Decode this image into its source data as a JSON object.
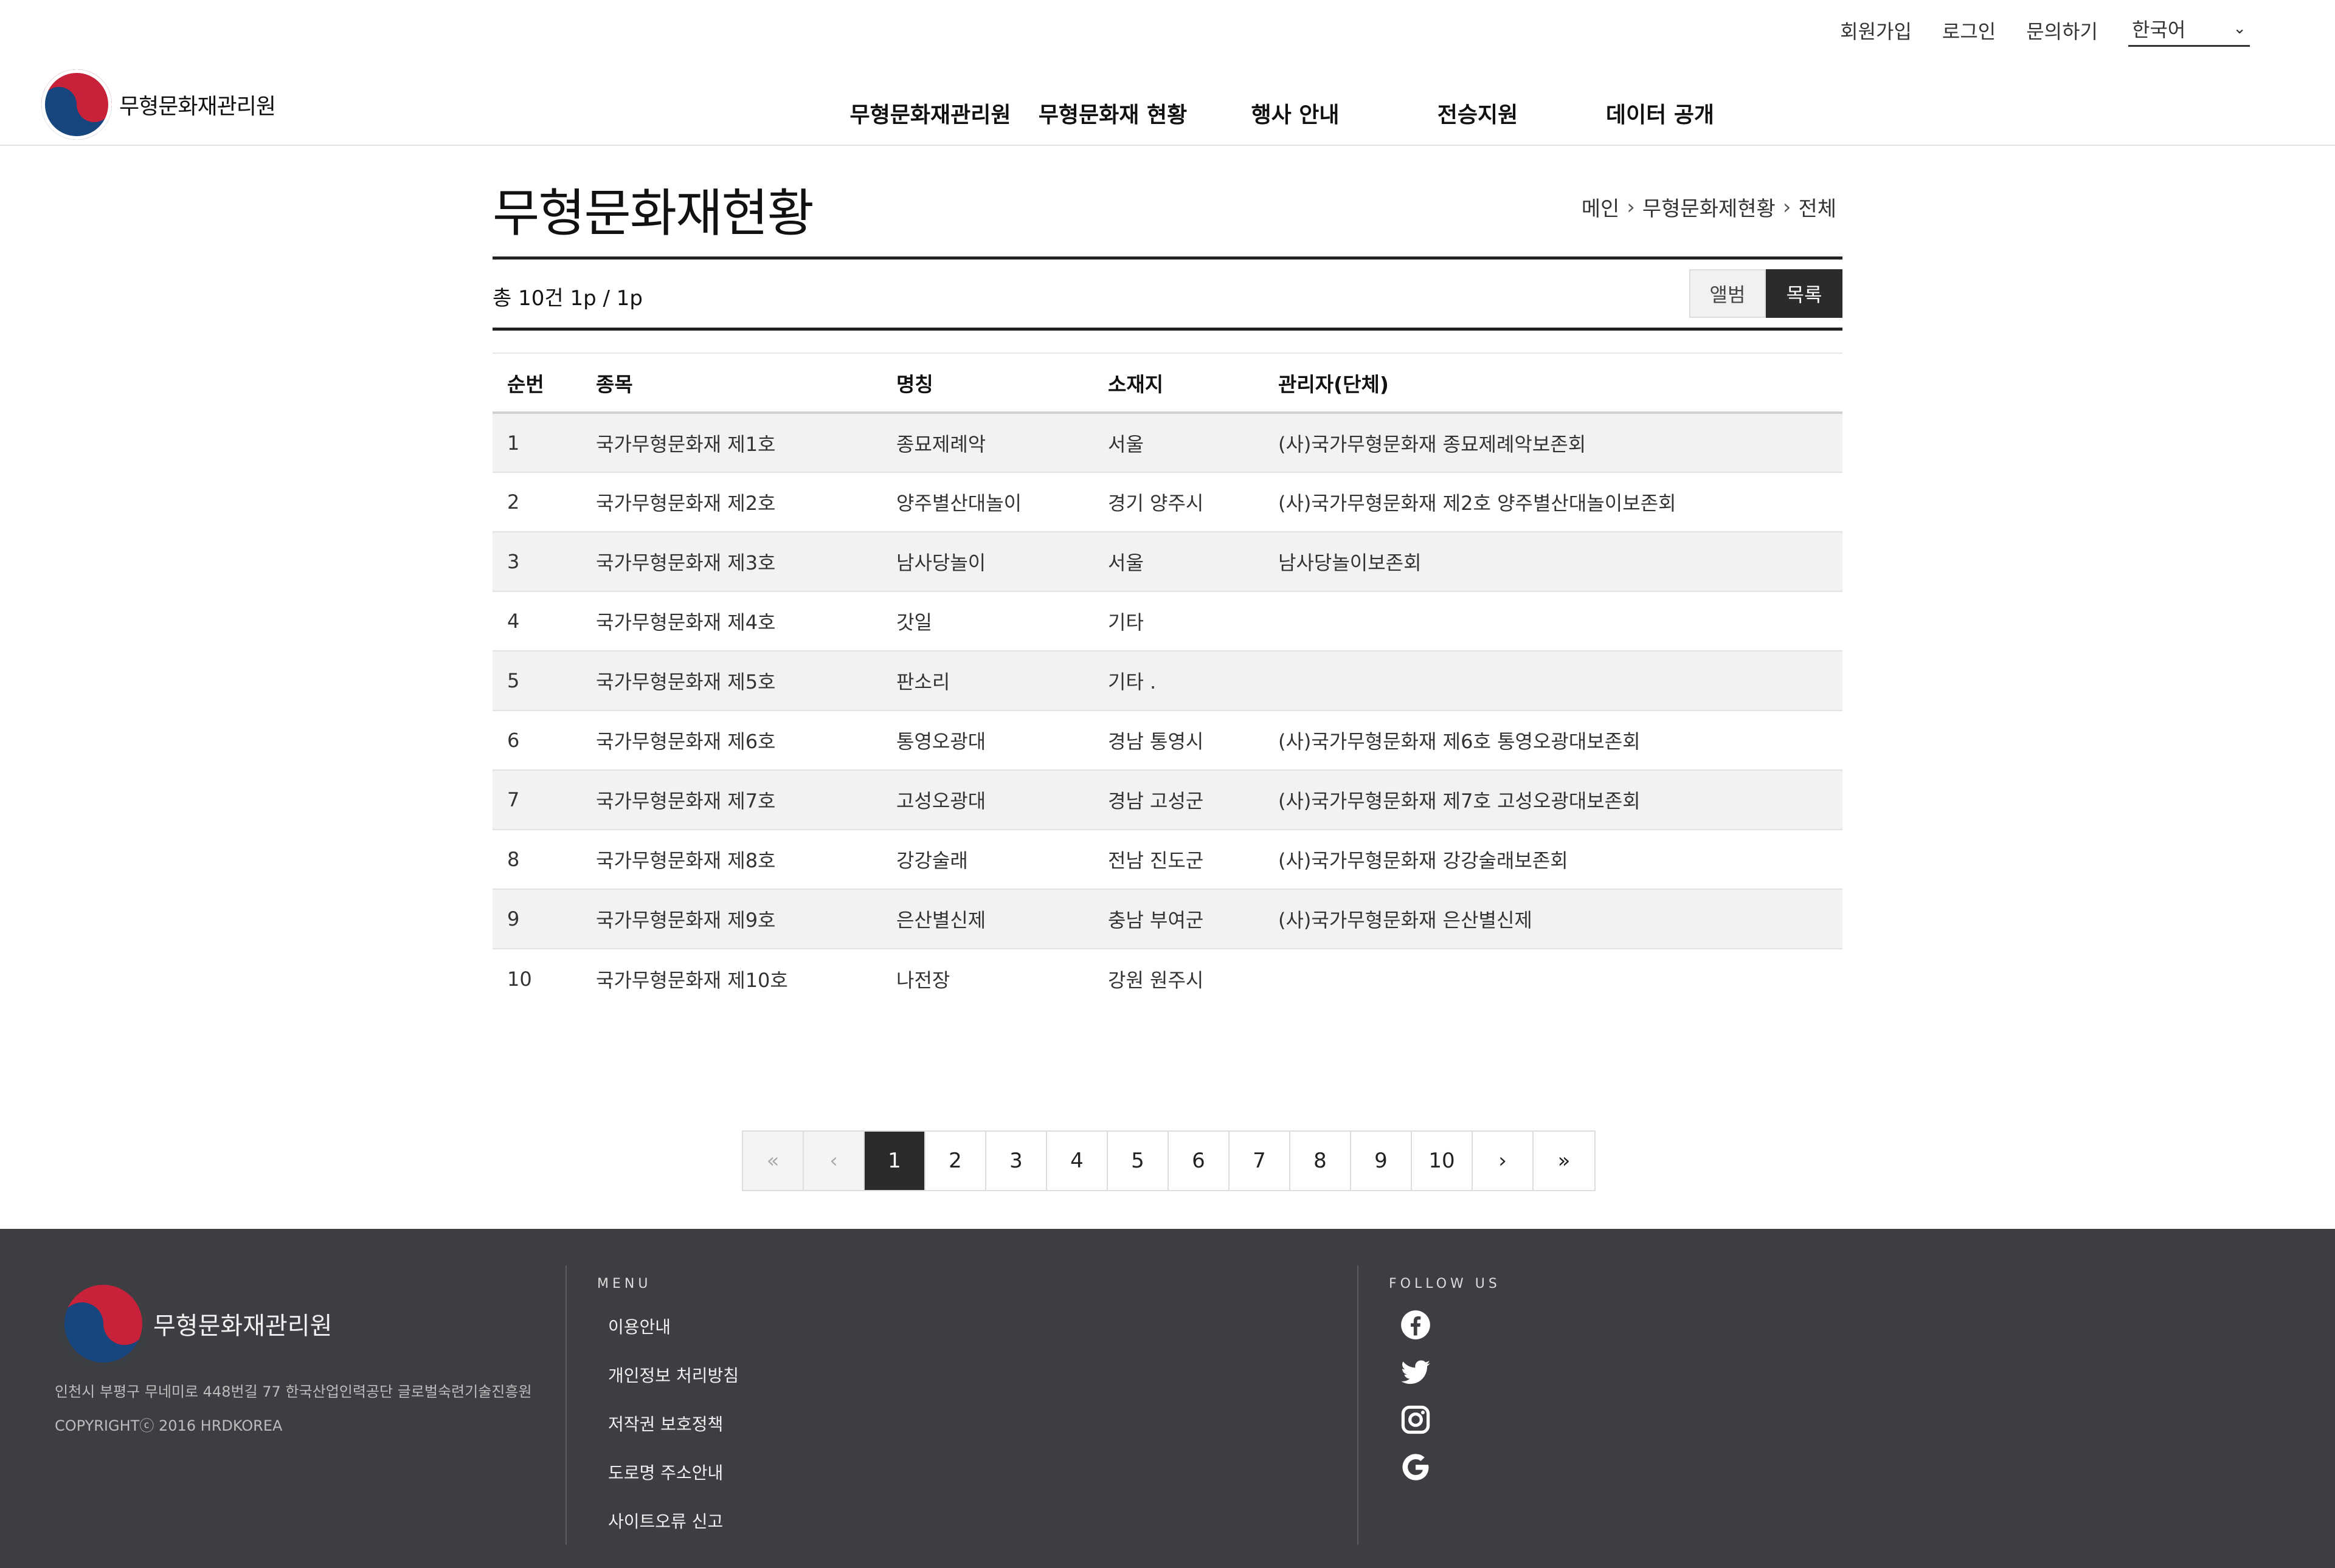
{
  "util": {
    "signup": "회원가입",
    "login": "로그인",
    "contact": "문의하기",
    "language": "한국어"
  },
  "header": {
    "logo_text": "무형문화재관리원",
    "nav": [
      "무형문화재관리원",
      "무형문화재 현황",
      "행사 안내",
      "전승지원",
      "데이터 공개"
    ]
  },
  "page": {
    "title": "무형문화재현황",
    "breadcrumb": [
      "메인",
      "무형문화제현황",
      "전체"
    ],
    "count_text": "총 10건 1p / 1p",
    "view_album": "앨범",
    "view_list": "목록"
  },
  "table": {
    "headers": [
      "순번",
      "종목",
      "명칭",
      "소재지",
      "관리자(단체)"
    ],
    "rows": [
      [
        "1",
        "국가무형문화재 제1호",
        "종묘제례악",
        "서울",
        "(사)국가무형문화재 종묘제례악보존회"
      ],
      [
        "2",
        "국가무형문화재 제2호",
        "양주별산대놀이",
        "경기 양주시",
        "(사)국가무형문화재 제2호 양주별산대놀이보존회"
      ],
      [
        "3",
        "국가무형문화재 제3호",
        "남사당놀이",
        "서울",
        "남사당놀이보존회"
      ],
      [
        "4",
        "국가무형문화재 제4호",
        "갓일",
        "기타",
        ""
      ],
      [
        "5",
        "국가무형문화재 제5호",
        "판소리",
        "기타 .",
        ""
      ],
      [
        "6",
        "국가무형문화재 제6호",
        "통영오광대",
        "경남 통영시",
        "(사)국가무형문화재 제6호 통영오광대보존회"
      ],
      [
        "7",
        "국가무형문화재 제7호",
        "고성오광대",
        "경남 고성군",
        "(사)국가무형문화재 제7호 고성오광대보존회"
      ],
      [
        "8",
        "국가무형문화재 제8호",
        "강강술래",
        "전남 진도군",
        "(사)국가무형문화재 강강술래보존회"
      ],
      [
        "9",
        "국가무형문화재 제9호",
        "은산별신제",
        "충남 부여군",
        "(사)국가무형문화재 은산별신제"
      ],
      [
        "10",
        "국가무형문화재 제10호",
        "나전장",
        "강원 원주시",
        ""
      ]
    ]
  },
  "pagination": {
    "pages": [
      "1",
      "2",
      "3",
      "4",
      "5",
      "6",
      "7",
      "8",
      "9",
      "10"
    ],
    "current": "1",
    "first": "«",
    "prev": "‹",
    "next": "›",
    "last": "»"
  },
  "footer": {
    "logo_text": "무형문화재관리원",
    "address": "인천시 부평구 무네미로 448번길 77 한국산업인력공단 글로벌숙련기술진흥원",
    "copyright": "COPYRIGHTⓒ 2016 HRDKOREA",
    "menu_heading": "MENU",
    "menu": [
      "이용안내",
      "개인정보 처리방침",
      "저작권 보호정책",
      "도로명 주소안내",
      "사이트오류 신고"
    ],
    "follow_heading": "FOLLOW US",
    "social_icons": [
      "facebook-icon",
      "twitter-icon",
      "instagram-icon",
      "google-icon"
    ]
  },
  "colors": {
    "brand_red": "#c8213a",
    "brand_blue": "#17457e",
    "footer_bg": "#3d3e42",
    "active_dark": "#2b2b2b"
  }
}
